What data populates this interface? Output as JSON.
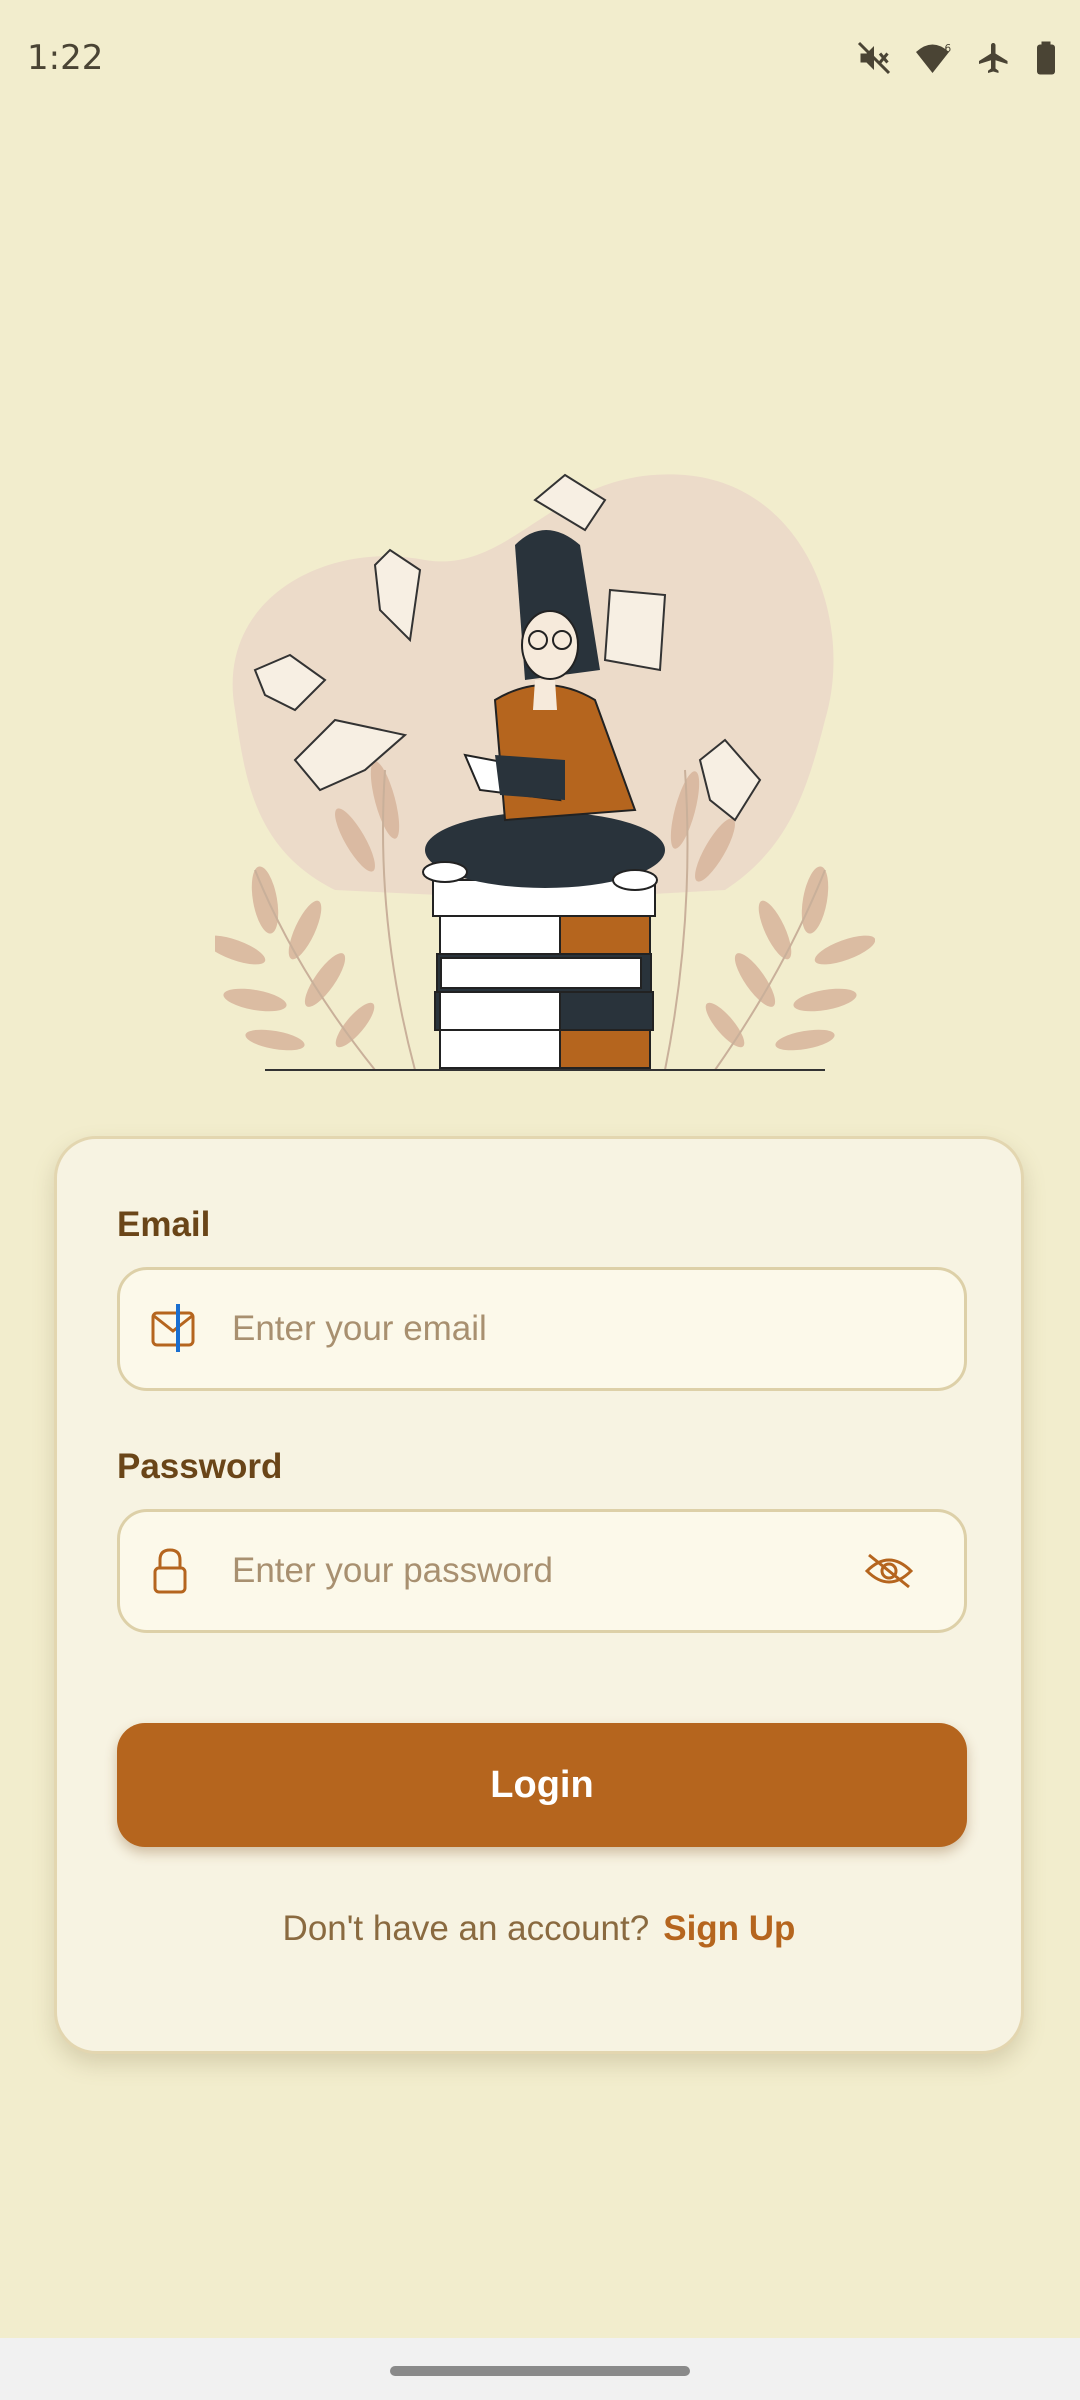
{
  "status_bar": {
    "time": "1:22",
    "icons": [
      "mute-icon",
      "wifi-icon",
      "airplane-mode-icon",
      "battery-icon"
    ]
  },
  "form": {
    "email": {
      "label": "Email",
      "placeholder": "Enter your email",
      "icon": "mail-icon"
    },
    "password": {
      "label": "Password",
      "placeholder": "Enter your password",
      "icon": "lock-icon",
      "toggle_icon": "eye-off-icon"
    },
    "login_label": "Login",
    "signup_prompt": "Don't have an account?",
    "signup_link": "Sign Up"
  },
  "colors": {
    "background": "#f2edcd",
    "card": "#f7f3e2",
    "accent": "#b5651e",
    "label": "#6a4518"
  }
}
